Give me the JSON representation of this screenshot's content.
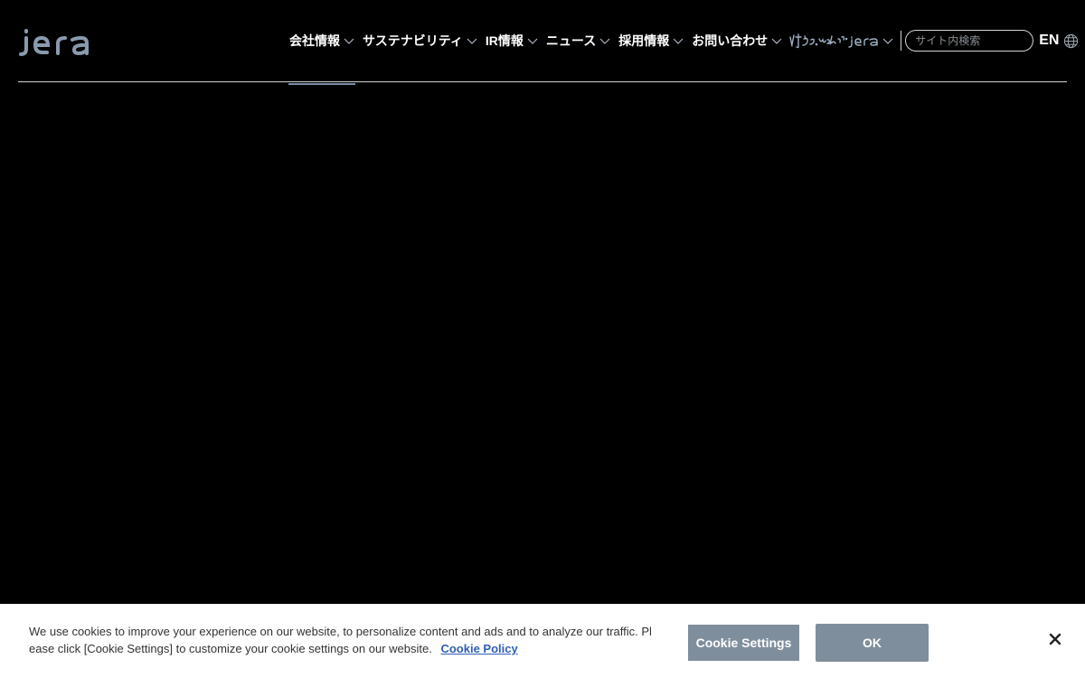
{
  "header": {
    "logo_text": "jera",
    "nav": [
      {
        "label": "会社情報",
        "active": true
      },
      {
        "label": "サステナビリティ",
        "active": false
      },
      {
        "label": "IR情報",
        "active": false
      },
      {
        "label": "ニュース",
        "active": false
      },
      {
        "label": "採用情報",
        "active": false
      },
      {
        "label": "お問い合わせ",
        "active": false
      }
    ],
    "tomosou_logo_text": "灯そう、みんなで。jera",
    "search": {
      "placeholder": "サイト内検索"
    },
    "lang_label": "EN"
  },
  "cookie_banner": {
    "text": "We use cookies to improve your experience on our website, to personalize content and ads and to analyze our traffic. Please click [Cookie Settings] to customize your cookie settings on our website.",
    "policy_link": "Cookie Policy",
    "settings_button": "Cookie Settings",
    "ok_button": "OK"
  },
  "icons": {
    "chevron": "chevron-down-icon",
    "globe": "globe-icon",
    "close": "close-icon"
  },
  "colors": {
    "background": "#000000",
    "accent_underline": "#7d8fa6",
    "button": "#7f8e9c",
    "link": "#2f5fb3"
  }
}
